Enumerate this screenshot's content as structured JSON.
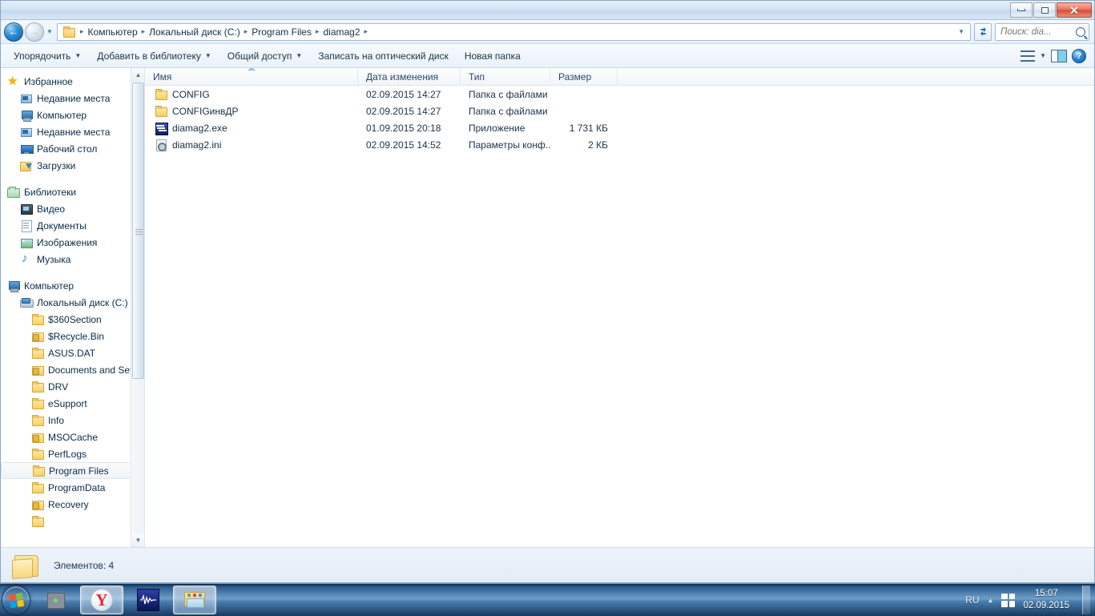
{
  "window": {
    "controls": {
      "minimize": "—",
      "restore": "❐",
      "close": "✕"
    }
  },
  "address": {
    "back_icon": "back-arrow",
    "forward_icon": "forward-arrow",
    "history_caret": "▼",
    "breadcrumbs": [
      "Компьютер",
      "Локальный диск (C:)",
      "Program Files",
      "diamag2"
    ],
    "separator": "▸",
    "dropdown_caret": "▼",
    "refresh_label": "↻",
    "search_placeholder": "Поиск: dia..."
  },
  "toolbar": {
    "items": [
      {
        "label": "Упорядочить",
        "has_caret": true
      },
      {
        "label": "Добавить в библиотеку",
        "has_caret": true
      },
      {
        "label": "Общий доступ",
        "has_caret": true
      },
      {
        "label": "Записать на оптический диск",
        "has_caret": false
      },
      {
        "label": "Новая папка",
        "has_caret": false
      }
    ],
    "view_caret": "▼",
    "help_label": "?"
  },
  "navigation": {
    "sections": [
      {
        "header": {
          "label": "Избранное",
          "icon": "star-icon"
        },
        "items": [
          {
            "label": "Недавние места",
            "icon": "recent-places-icon",
            "level": 1
          },
          {
            "label": "Компьютер",
            "icon": "computer-icon",
            "level": 1
          },
          {
            "label": "Недавние места",
            "icon": "recent-places-icon",
            "level": 1
          },
          {
            "label": "Рабочий стол",
            "icon": "desktop-icon",
            "level": 1
          },
          {
            "label": "Загрузки",
            "icon": "downloads-icon",
            "level": 1
          }
        ]
      },
      {
        "header": {
          "label": "Библиотеки",
          "icon": "libraries-icon"
        },
        "items": [
          {
            "label": "Видео",
            "icon": "video-icon",
            "level": 1
          },
          {
            "label": "Документы",
            "icon": "document-icon",
            "level": 1
          },
          {
            "label": "Изображения",
            "icon": "pictures-icon",
            "level": 1
          },
          {
            "label": "Музыка",
            "icon": "music-icon",
            "level": 1
          }
        ]
      },
      {
        "header": {
          "label": "Компьютер",
          "icon": "computer-icon"
        },
        "items": [
          {
            "label": "Локальный диск (C:)",
            "icon": "drive-icon",
            "level": 1
          },
          {
            "label": "$360Section",
            "icon": "folder-icon",
            "level": 2
          },
          {
            "label": "$Recycle.Bin",
            "icon": "folder-lock-icon",
            "level": 2
          },
          {
            "label": "ASUS.DAT",
            "icon": "folder-icon",
            "level": 2
          },
          {
            "label": "Documents and Set",
            "icon": "folder-lock-icon",
            "level": 2
          },
          {
            "label": "DRV",
            "icon": "folder-icon",
            "level": 2
          },
          {
            "label": "eSupport",
            "icon": "folder-icon",
            "level": 2
          },
          {
            "label": "Info",
            "icon": "folder-icon",
            "level": 2
          },
          {
            "label": "MSOCache",
            "icon": "folder-lock-icon",
            "level": 2
          },
          {
            "label": "PerfLogs",
            "icon": "folder-icon",
            "level": 2
          },
          {
            "label": "Program Files",
            "icon": "folder-icon",
            "level": 2,
            "selected": true
          },
          {
            "label": "ProgramData",
            "icon": "folder-icon",
            "level": 2
          },
          {
            "label": "Recovery",
            "icon": "folder-lock-icon",
            "level": 2
          }
        ]
      }
    ],
    "scrollbar": {
      "up_arrow": "▲",
      "down_arrow": "▼"
    }
  },
  "filelist": {
    "columns": [
      "Имя",
      "Дата изменения",
      "Тип",
      "Размер"
    ],
    "rows": [
      {
        "name": "CONFIG",
        "icon": "folder-icon",
        "date": "02.09.2015 14:27",
        "type": "Папка с файлами",
        "size": ""
      },
      {
        "name": "CONFIGинвДР",
        "icon": "folder-icon",
        "date": "02.09.2015 14:27",
        "type": "Папка с файлами",
        "size": ""
      },
      {
        "name": "diamag2.exe",
        "icon": "exe-icon",
        "date": "01.09.2015 20:18",
        "type": "Приложение",
        "size": "1 731 КБ"
      },
      {
        "name": "diamag2.ini",
        "icon": "ini-icon",
        "date": "02.09.2015 14:52",
        "type": "Параметры конф...",
        "size": "2 КБ"
      }
    ]
  },
  "statusbar": {
    "text": "Элементов: 4",
    "icon": "open-folder-icon"
  },
  "taskbar": {
    "start_icon": "windows-start-orb",
    "buttons": [
      {
        "icon": "device-icon",
        "active": false,
        "name": "taskbar-device"
      },
      {
        "icon": "yandex-icon",
        "active": true,
        "name": "taskbar-yandex",
        "glyph": "Y"
      },
      {
        "icon": "waveform-icon",
        "active": false,
        "name": "taskbar-diamag"
      },
      {
        "icon": "explorer-icon",
        "active": true,
        "name": "taskbar-explorer"
      }
    ],
    "tray": {
      "language": "RU",
      "caret": "▲",
      "flag_icon": "windows-flag-icon",
      "time": "15:07",
      "date": "02.09.2015"
    }
  },
  "colors": {
    "accent": "#2f7ac0",
    "close_red": "#d44a32",
    "folder_yellow": "#f3c75a",
    "taskbar_blue": "#4a7fb0"
  }
}
